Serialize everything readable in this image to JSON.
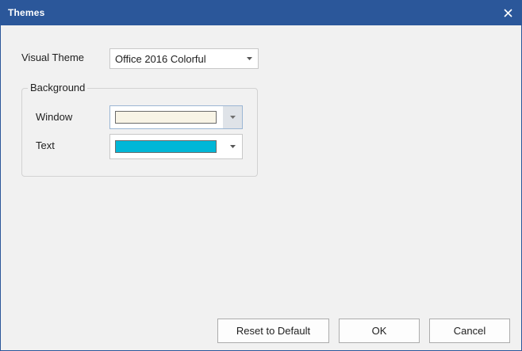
{
  "dialog": {
    "title": "Themes",
    "close_icon": "close-icon"
  },
  "visual_theme": {
    "label": "Visual Theme",
    "value": "Office 2016 Colorful"
  },
  "background_group": {
    "legend": "Background",
    "window": {
      "label": "Window",
      "color": "#f8f4e6"
    },
    "text": {
      "label": "Text",
      "color": "#00b7d7"
    }
  },
  "buttons": {
    "reset": "Reset to Default",
    "ok": "OK",
    "cancel": "Cancel"
  },
  "colors": {
    "titlebar": "#2b579a",
    "dialog_background": "#f1f1f1"
  }
}
